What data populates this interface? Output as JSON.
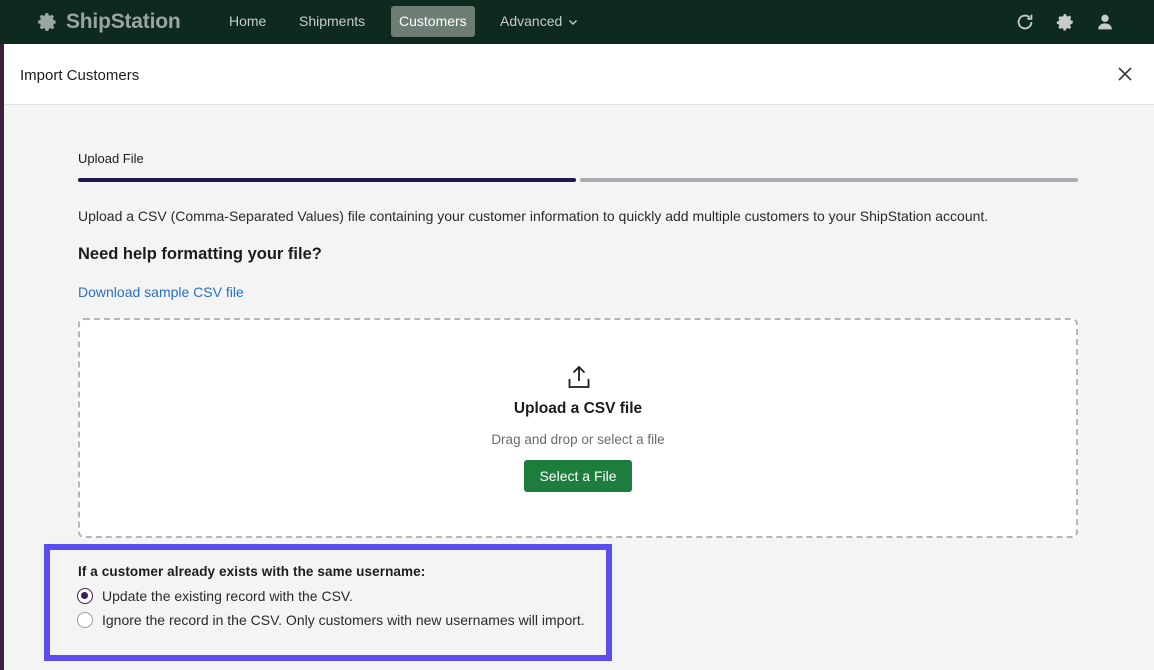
{
  "app": {
    "name": "ShipStation"
  },
  "nav": {
    "items": [
      {
        "label": "Home"
      },
      {
        "label": "Shipments"
      },
      {
        "label": "Customers"
      },
      {
        "label": "Advanced"
      }
    ],
    "active": "Customers",
    "icons": [
      "refresh-icon",
      "gear-icon",
      "user-icon"
    ]
  },
  "modal": {
    "title": "Import Customers",
    "step": {
      "label": "Upload File",
      "progress": 0.5
    },
    "intro": "Upload a CSV (Comma-Separated Values) file containing your customer information to quickly add multiple customers to your ShipStation account.",
    "help_title": "Need help formatting your file?",
    "sample_link": "Download sample CSV file",
    "dropzone": {
      "title": "Upload a CSV file",
      "subtitle": "Drag and drop or select a file",
      "button": "Select a File"
    },
    "duplicate_options": {
      "label": "If a customer already exists with the same username:",
      "options": [
        {
          "label": "Update the existing record with the CSV.",
          "selected": true
        },
        {
          "label": "Ignore the record in the CSV. Only customers with new usernames will import.",
          "selected": false
        }
      ]
    }
  },
  "colors": {
    "nav_bg": "#0e2a1e",
    "primary_button": "#1e7c3c",
    "link": "#2b6fc2",
    "highlight_border": "#5b4ef0",
    "progress_done": "#1f1a4a"
  }
}
